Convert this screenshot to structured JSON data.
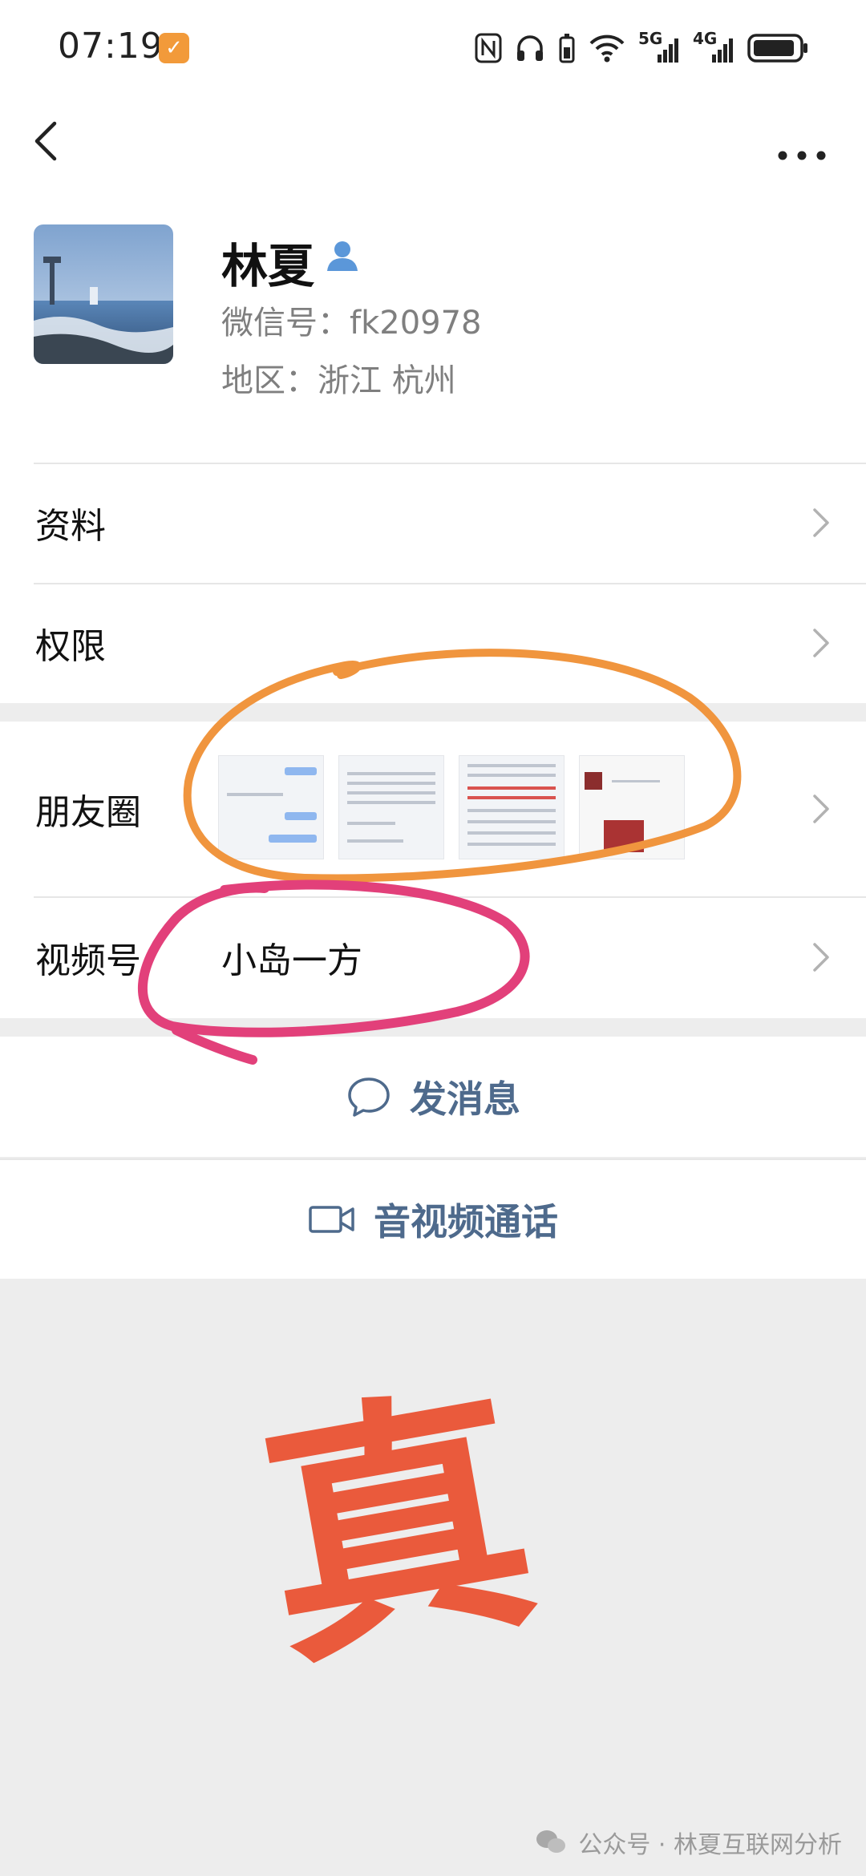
{
  "status_bar": {
    "time": "07:19",
    "network_5g": "5G",
    "network_4g": "4G"
  },
  "profile": {
    "name": "林夏",
    "wechat_id": "微信号：fk20978",
    "region": "地区：浙江  杭州"
  },
  "rows": {
    "info": "资料",
    "permissions": "权限",
    "moments": "朋友圈",
    "channels": "视频号",
    "channels_value": "小岛一方"
  },
  "actions": {
    "message": "发消息",
    "call": "音视频通话"
  },
  "annotation": {
    "big_char": "真"
  },
  "watermark": "公众号 · 林夏互联网分析",
  "colors": {
    "accent_text": "#4e6a8c",
    "orange_circle": "#f0953e",
    "pink_circle": "#e2407a",
    "red_char": "#ea5a3c"
  }
}
